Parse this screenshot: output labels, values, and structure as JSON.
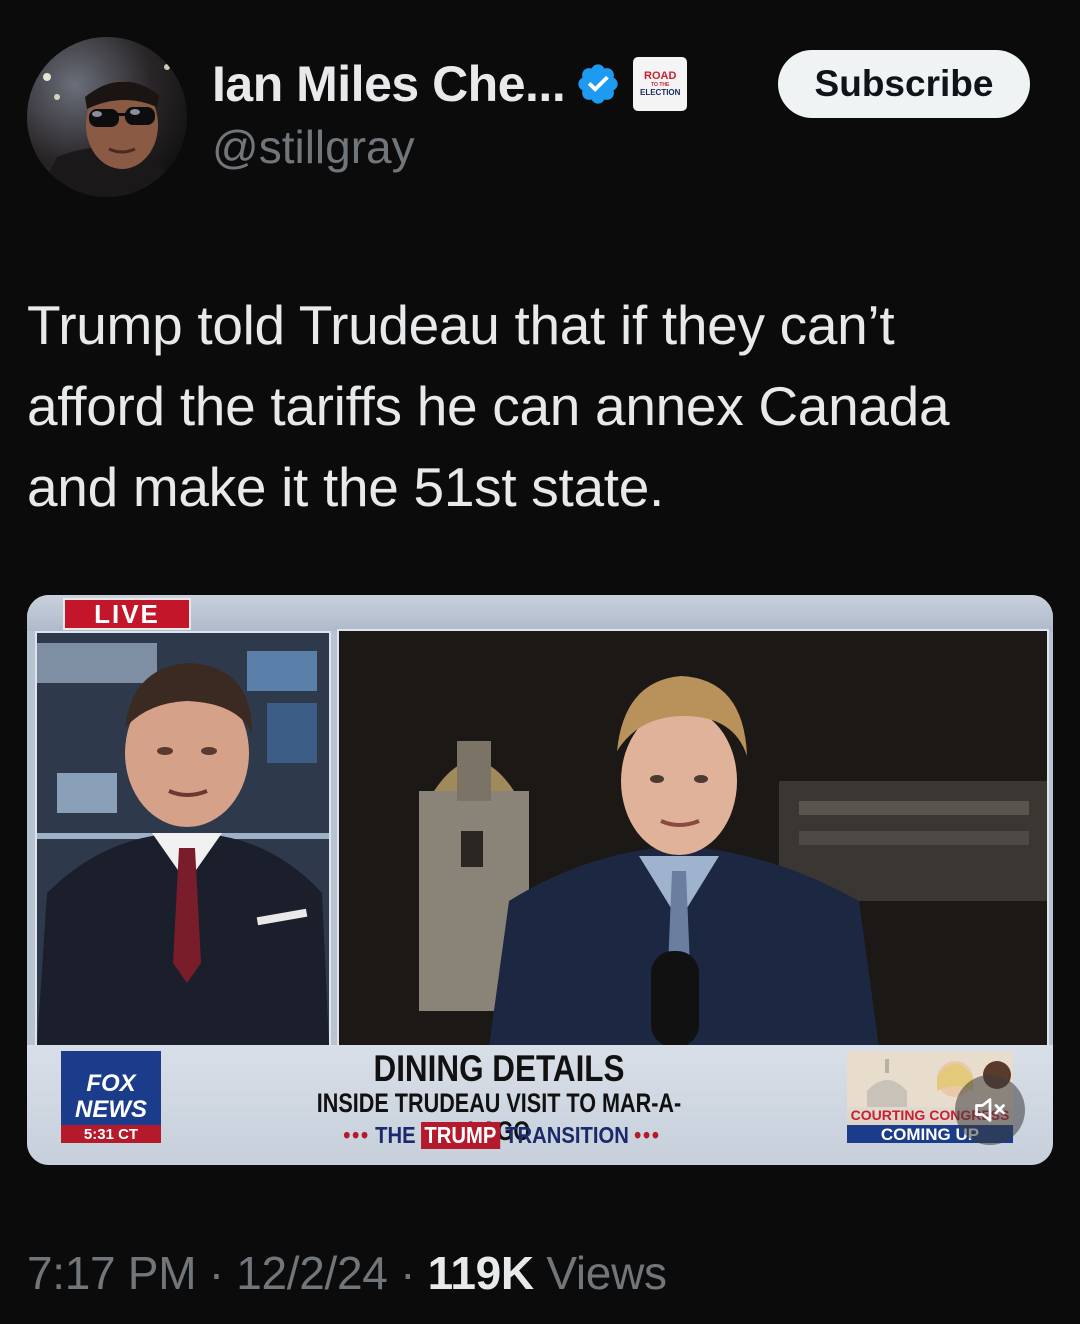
{
  "author": {
    "display_name": "Ian Miles Che...",
    "handle": "@stillgray",
    "affiliate_badge": {
      "line1": "ROAD",
      "line2": "TO THE",
      "line3": "ELECTION"
    }
  },
  "actions": {
    "subscribe_label": "Subscribe"
  },
  "tweet": {
    "text": "Trump told Trudeau that if they can’t afford the tariffs he can annex Canada and make it the 51st state."
  },
  "media": {
    "live_label": "LIVE",
    "network_logo": "FOX\nNEWS",
    "clock": "5:31 CT",
    "headline": "DINING DETAILS",
    "subheadline": "INSIDE TRUDEAU VISIT TO MAR-A-LAGO",
    "ticker": {
      "prefix": "THE",
      "highlight": "TRUMP",
      "suffix": "TRANSITION"
    },
    "promo": {
      "line1": "COURTING CONGRESS",
      "line2": "COMING UP"
    },
    "mute_icon": "speaker-muted-icon"
  },
  "meta": {
    "time": "7:17 PM",
    "separator": "·",
    "date": "12/2/24",
    "views_count": "119K",
    "views_label": "Views"
  },
  "colors": {
    "background": "#0b0b0c",
    "text_primary": "#e7e9ea",
    "text_secondary": "#71767b",
    "verified_blue": "#1d9bf0",
    "fox_red": "#b5192c",
    "fox_blue": "#1a3c8a"
  }
}
